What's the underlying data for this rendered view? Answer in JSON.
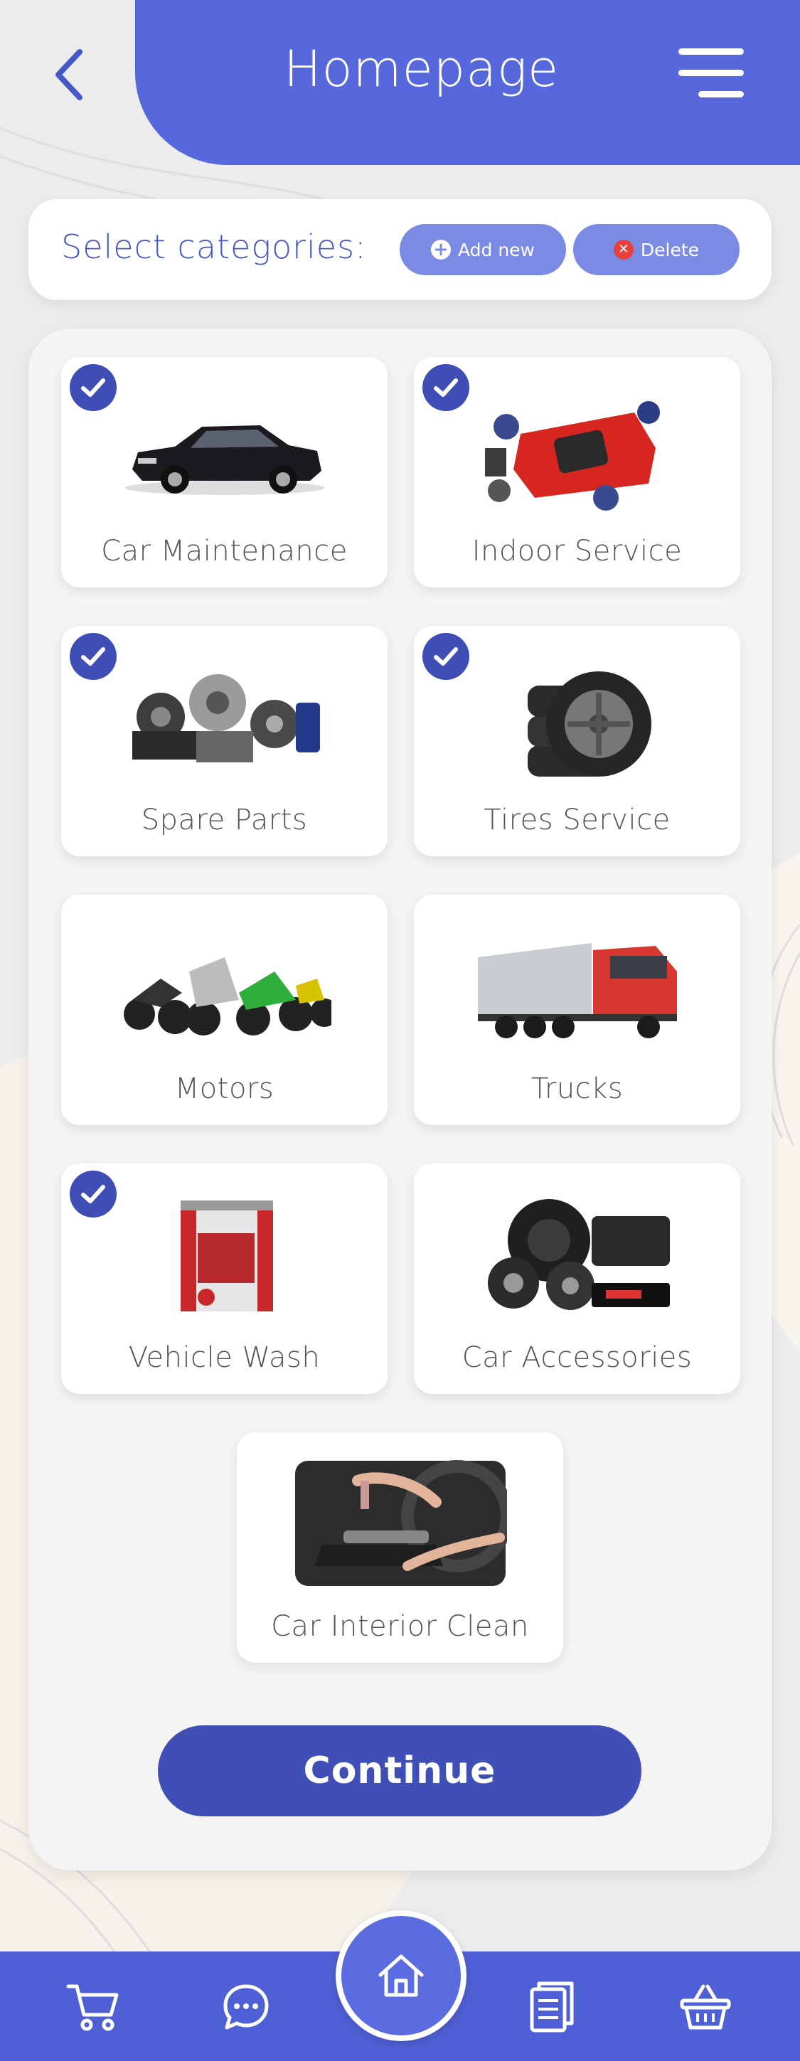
{
  "header": {
    "title": "Homepage",
    "back_icon": "chevron-left-icon",
    "menu_icon": "hamburger-menu-icon"
  },
  "categories_bar": {
    "label": "Select categories:",
    "add_label": "Add new",
    "delete_label": "Delete"
  },
  "categories": [
    {
      "label": "Car Maintenance",
      "selected": true,
      "icon": "sedan-car-image"
    },
    {
      "label": "Indoor Service",
      "selected": true,
      "icon": "mechanics-red-car-image"
    },
    {
      "label": "Spare Parts",
      "selected": true,
      "icon": "spare-parts-image"
    },
    {
      "label": "Tires Service",
      "selected": true,
      "icon": "tires-stack-image"
    },
    {
      "label": "Motors",
      "selected": false,
      "icon": "motorcycles-image"
    },
    {
      "label": "Trucks",
      "selected": false,
      "icon": "truck-image"
    },
    {
      "label": "Vehicle Wash",
      "selected": true,
      "icon": "car-wash-machine-image"
    },
    {
      "label": "Car Accessories",
      "selected": false,
      "icon": "car-audio-speakers-image"
    },
    {
      "label": "Car Interior Clean",
      "selected": false,
      "icon": "interior-cleaning-image"
    }
  ],
  "continue_label": "Continue",
  "bottom_nav": [
    {
      "name": "cart-icon"
    },
    {
      "name": "chat-icon"
    },
    {
      "name": "home-icon"
    },
    {
      "name": "documents-icon"
    },
    {
      "name": "basket-icon"
    }
  ],
  "colors": {
    "primary": "#5668dc",
    "dark_primary": "#3f4fb6",
    "pill": "#7b8be4",
    "delete_red": "#e8413d",
    "panel": "#f4f4f5"
  }
}
